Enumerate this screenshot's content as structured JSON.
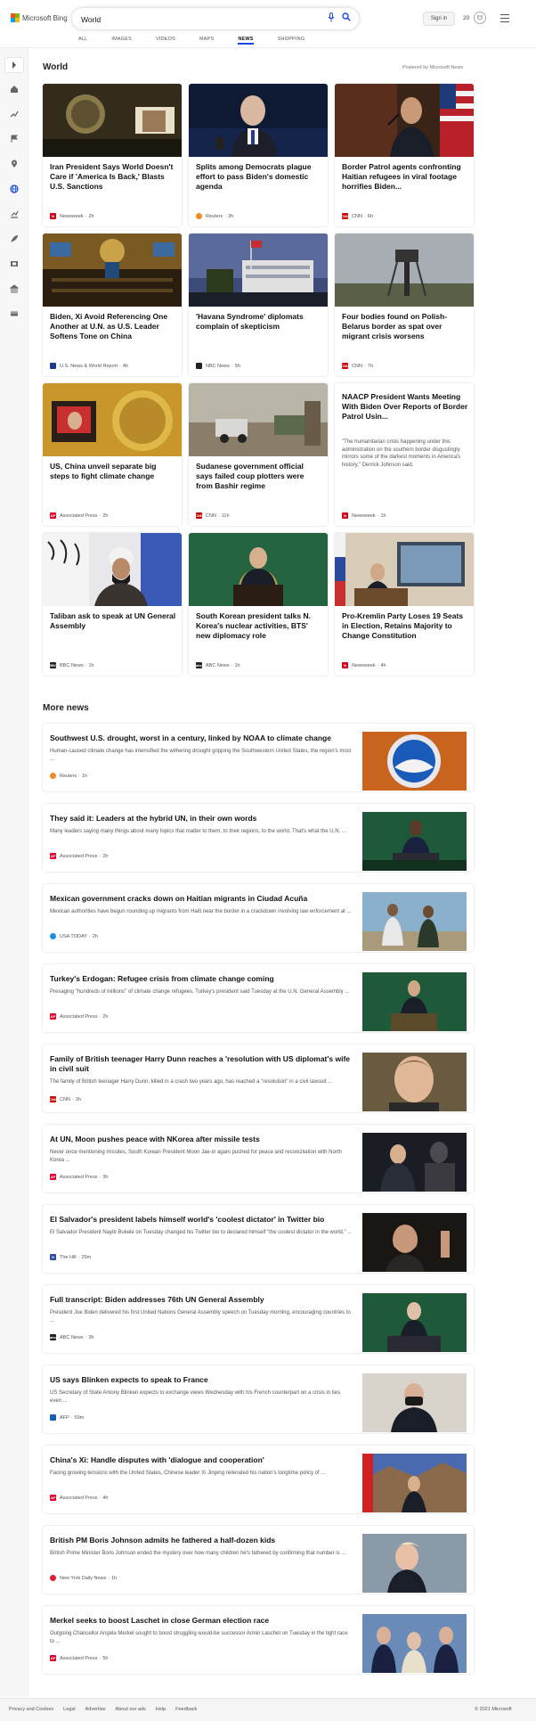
{
  "brand": {
    "logo_text": "Microsoft Bing",
    "logo_colors": [
      "#f25022",
      "#7fba00",
      "#00a4ef",
      "#ffb900"
    ]
  },
  "search": {
    "query": "World"
  },
  "header": {
    "signin": "Sign in",
    "rewards_count": "20"
  },
  "tabs": [
    {
      "label": "ALL",
      "active": false
    },
    {
      "label": "IMAGES",
      "active": false
    },
    {
      "label": "VIDEOS",
      "active": false
    },
    {
      "label": "MAPS",
      "active": false
    },
    {
      "label": "NEWS",
      "active": true
    },
    {
      "label": "SHOPPING",
      "active": false
    }
  ],
  "section": {
    "title": "World",
    "powered_by": "Powered by Microsoft News"
  },
  "cards": [
    {
      "title": "Iran President Says World Doesn't Care if 'America Is Back,' Blasts U.S. Sanctions",
      "source": "Newsweek",
      "time": "2h",
      "source_color": "#d0021b",
      "source_mark": "N"
    },
    {
      "title": "Splits among Democrats plague effort to pass Biden's domestic agenda",
      "source": "Reuters",
      "time": "3h",
      "source_color": "#f08a24",
      "source_mark": ""
    },
    {
      "title": "Border Patrol agents confronting Haitian refugees in viral footage horrifies Biden...",
      "source": "CNN",
      "time": "6h",
      "source_color": "#cc0000",
      "source_mark": "CNN"
    },
    {
      "title": "Biden, Xi Avoid Referencing One Another at U.N. as U.S. Leader Softens Tone on China",
      "source": "U.S. News & World Report",
      "time": "4h",
      "source_color": "#1a3a8f",
      "source_mark": ""
    },
    {
      "title": "'Havana Syndrome' diplomats complain of skepticism",
      "source": "NBC News",
      "time": "5h",
      "source_color": "#222222",
      "source_mark": ""
    },
    {
      "title": "Four bodies found on Polish-Belarus border as spat over migrant crisis worsens",
      "source": "CNN",
      "time": "7h",
      "source_color": "#cc0000",
      "source_mark": "CNN"
    },
    {
      "title": "US, China unveil separate big steps to fight climate change",
      "source": "Associated Press",
      "time": "2h",
      "source_color": "#e4002b",
      "source_mark": "AP"
    },
    {
      "title": "Sudanese government official says failed coup plotters were from Bashir regime",
      "source": "CNN",
      "time": "11h",
      "source_color": "#cc0000",
      "source_mark": "CNN"
    },
    {
      "title": "NAACP President Wants Meeting With Biden Over Reports of Border Patrol Usin...",
      "snippet": "\"The humanitarian crisis happening under this administration on the southern border disgustingly mirrors some of the darkest moments in America's history,\" Derrick Johnson said.",
      "source": "Newsweek",
      "time": "1h",
      "source_color": "#d0021b",
      "source_mark": "N"
    },
    {
      "title": "Taliban ask to speak at UN General Assembly",
      "source": "BBC News",
      "time": "1h",
      "source_color": "#222222",
      "source_mark": "BBC"
    },
    {
      "title": "South Korean president talks N. Korea's nuclear activities, BTS' new diplomacy role",
      "source": "ABC News",
      "time": "1h",
      "source_color": "#222222",
      "source_mark": "abc"
    },
    {
      "title": "Pro-Kremlin Party Loses 19 Seats in Election, Retains Majority to Change Constitution",
      "source": "Newsweek",
      "time": "4h",
      "source_color": "#d0021b",
      "source_mark": "N"
    }
  ],
  "more_news": {
    "title": "More news",
    "items": [
      {
        "title": "Southwest U.S. drought, worst in a century, linked by NOAA to climate change",
        "snippet": "Human-caused climate change has intensified the withering drought gripping the Southwestern United States, the region's most ...",
        "source": "Reuters",
        "time": "1h",
        "source_color": "#f08a24",
        "source_mark": ""
      },
      {
        "title": "They said it: Leaders at the hybrid UN, in their own words",
        "snippet": "Many leaders saying many things about many topics that matter to them, to their regions, to the world. That's what the U.N. ...",
        "source": "Associated Press",
        "time": "2h",
        "source_color": "#e4002b",
        "source_mark": "AP"
      },
      {
        "title": "Mexican government cracks down on Haitian migrants in Ciudad Acuña",
        "snippet": "Mexican authorities have begun rounding up migrants from Haiti near the border in a crackdown involving law enforcement at ...",
        "source": "USA TODAY",
        "time": "2h",
        "source_color": "#1a8fe3",
        "source_mark": ""
      },
      {
        "title": "Turkey's Erdogan: Refugee crisis from climate change coming",
        "snippet": "Presaging \"hundreds of millions\" of climate change refugees, Turkey's president said Tuesday at the U.N. General Assembly ...",
        "source": "Associated Press",
        "time": "2h",
        "source_color": "#e4002b",
        "source_mark": "AP"
      },
      {
        "title": "Family of British teenager Harry Dunn reaches a 'resolution with US diplomat's wife in civil suit",
        "snippet": "The family of British teenager Harry Dunn, killed in a crash two years ago, has reached a \"resolution\" in a civil lawsuit ...",
        "source": "CNN",
        "time": "3h",
        "source_color": "#cc0000",
        "source_mark": "CNN"
      },
      {
        "title": "At UN, Moon pushes peace with NKorea after missile tests",
        "snippet": "Never once mentioning missiles, South Korean President Moon Jae-in again pushed for peace and reconciliation with North Korea ...",
        "source": "Associated Press",
        "time": "3h",
        "source_color": "#e4002b",
        "source_mark": "AP"
      },
      {
        "title": "El Salvador's president labels himself world's 'coolest dictator' in Twitter bio",
        "snippet": "El Salvador President Nayib Bukele on Tuesday changed his Twitter bio to declared himself \"the coolest dictator in the world,\" ...",
        "source": "The Hill",
        "time": "29m",
        "source_color": "#2b4aa6",
        "source_mark": "H"
      },
      {
        "title": "Full transcript: Biden addresses 76th UN General Assembly",
        "snippet": "President Joe Biden delivered his first United Nations General Assembly speech on Tuesday morning, encouraging countries to ...",
        "source": "ABC News",
        "time": "3h",
        "source_color": "#222222",
        "source_mark": "abc"
      },
      {
        "title": "US says Blinken expects to speak to France",
        "snippet": "US Secretary of State Antony Blinken expects to exchange views Wednesday with his French counterpart on a crisis in ties even ...",
        "source": "AFP",
        "time": "59m",
        "source_color": "#1a5fb4",
        "source_mark": ""
      },
      {
        "title": "China's Xi: Handle disputes with 'dialogue and cooperation'",
        "snippet": "Facing growing tensions with the United States, Chinese leader Xi Jinping reiterated his nation's longtime policy of ...",
        "source": "Associated Press",
        "time": "4h",
        "source_color": "#e4002b",
        "source_mark": "AP"
      },
      {
        "title": "British PM Boris Johnson admits he fathered a half-dozen kids",
        "snippet": "British Prime Minister Boris Johnson ended the mystery over how many children he's fathered by confirming that number is ...",
        "source": "New York Daily News",
        "time": "1h",
        "source_color": "#e01e37",
        "source_mark": ""
      },
      {
        "title": "Merkel seeks to boost Laschet in close German election race",
        "snippet": "Outgoing Chancellor Angela Merkel sought to boost struggling would-be successor Armin Laschet on Tuesday in the tight race to ...",
        "source": "Associated Press",
        "time": "5h",
        "source_color": "#e4002b",
        "source_mark": "AP"
      }
    ]
  },
  "footer": {
    "links": [
      "Privacy and Cookies",
      "Legal",
      "Advertise",
      "About our ads",
      "Help",
      "Feedback"
    ],
    "copyright": "© 2021 Microsoft"
  }
}
